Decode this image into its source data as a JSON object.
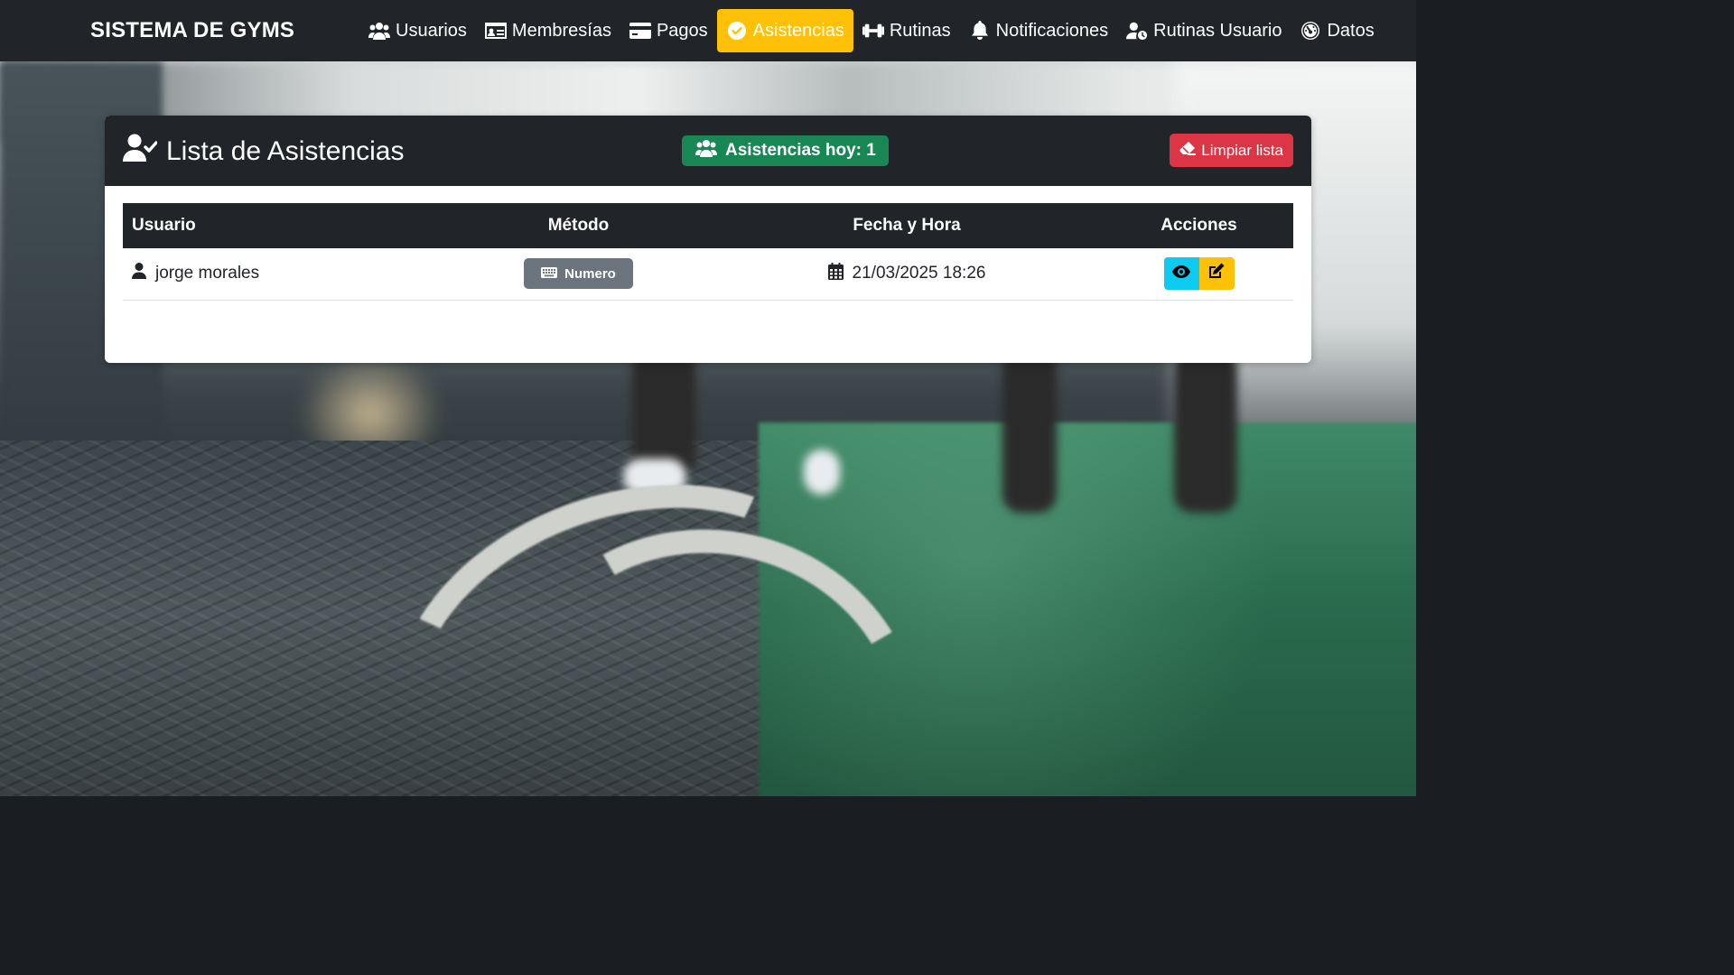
{
  "navbar": {
    "brand": "SISTEMA DE GYMS",
    "items": [
      {
        "label": "Usuarios",
        "icon": "users-icon"
      },
      {
        "label": "Membresías",
        "icon": "id-card-icon"
      },
      {
        "label": "Pagos",
        "icon": "credit-card-icon"
      },
      {
        "label": "Asistencias",
        "icon": "check-circle-icon",
        "active": true
      },
      {
        "label": "Rutinas",
        "icon": "dumbbell-icon"
      },
      {
        "label": "Notificaciones",
        "icon": "bell-icon"
      },
      {
        "label": "Rutinas Usuario",
        "icon": "user-clock-icon"
      },
      {
        "label": "Datos",
        "icon": "gauge-icon"
      }
    ],
    "active_color": "#ffc107"
  },
  "card": {
    "title": "Lista de Asistencias",
    "title_icon": "user-check-icon",
    "count_badge": "Asistencias hoy: 1",
    "clear_button": "Limpiar lista"
  },
  "table": {
    "headers": [
      "Usuario",
      "Método",
      "Fecha y Hora",
      "Acciones"
    ],
    "rows": [
      {
        "usuario": "jorge morales",
        "metodo": "Numero",
        "fecha": "21/03/2025 18:26"
      }
    ]
  },
  "colors": {
    "dark": "#212529",
    "success": "#198754",
    "danger": "#dc3545",
    "secondary": "#6c757d",
    "info": "#0dcaf0",
    "warning": "#ffc107"
  }
}
